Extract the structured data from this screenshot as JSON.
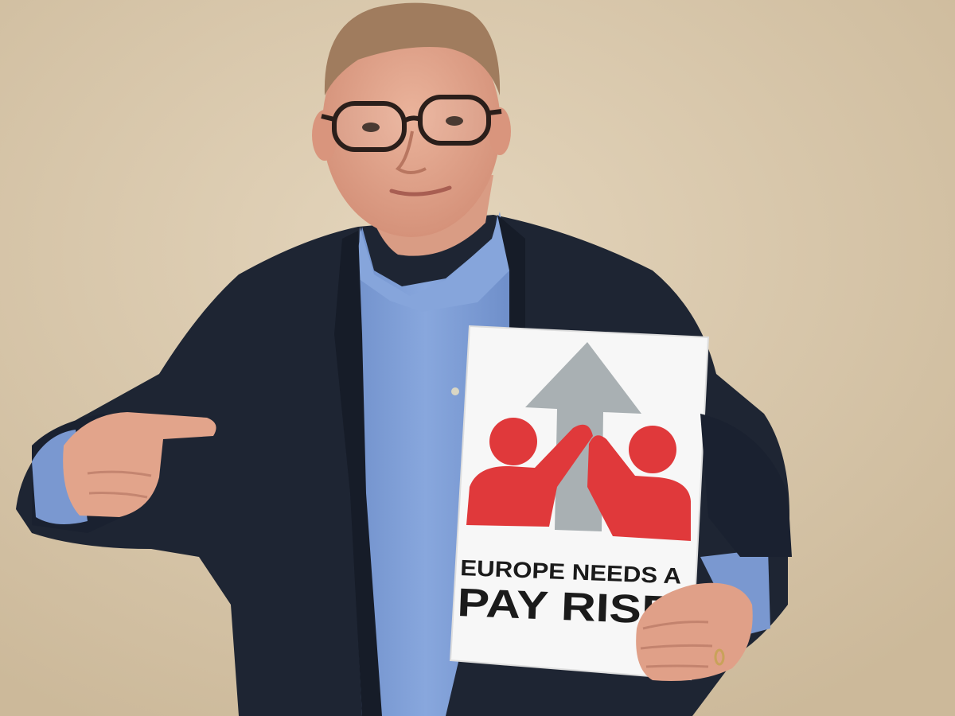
{
  "photo": {
    "subject": "man-holding-campaign-sign",
    "colors": {
      "wall": "#d9c8ad",
      "jacket": "#1e2533",
      "shirt": "#7f9fd6",
      "skin": "#e3a58c",
      "sign_background": "#f7f7f7",
      "arrow": "#a9b0b3",
      "figures": "#e0393b",
      "sign_text": "#1b1b1b"
    }
  },
  "sign": {
    "line1": "EUROPE NEEDS A",
    "line2": "PAY RISE",
    "logo_icons": [
      "up-arrow-icon",
      "person-icon",
      "person-icon"
    ]
  }
}
